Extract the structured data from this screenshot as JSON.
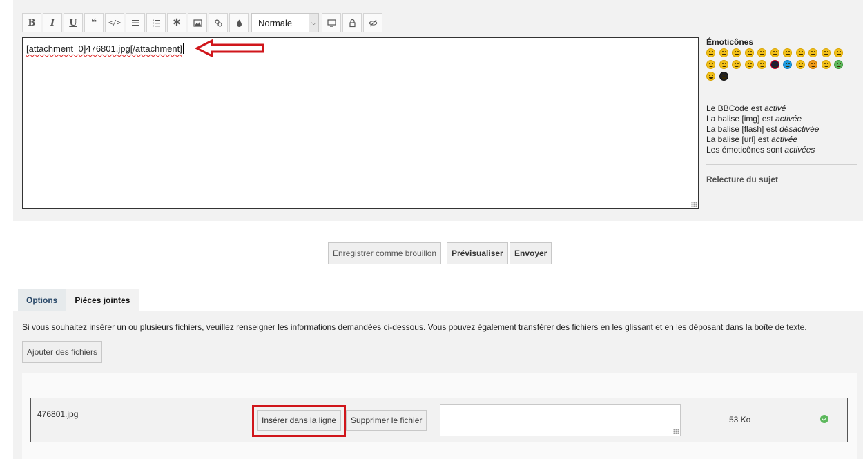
{
  "toolbar": {
    "buttons": [
      "bold-button",
      "italic-button",
      "underline-button",
      "quote-button",
      "code-button",
      "list-button",
      "numbered-list-button",
      "list-item-button",
      "image-button",
      "link-button",
      "color-button"
    ],
    "bold_label": "B",
    "italic_label": "I",
    "underline_label": "U",
    "font_size_value": "Normale"
  },
  "editor": {
    "content": "[attachment=0]476801.jpg[/attachment]"
  },
  "sidebar": {
    "emoticons_title": "Émoticônes",
    "bbcode_lines": [
      {
        "prefix": "Le BBCode est ",
        "state": "activé"
      },
      {
        "prefix": "La balise [img] est ",
        "state": "activée"
      },
      {
        "prefix": "La balise [flash] est ",
        "state": "désactivée"
      },
      {
        "prefix": "La balise [url] est ",
        "state": "activée"
      },
      {
        "prefix": "Les émoticônes sont ",
        "state": "activées"
      }
    ],
    "topic_review": "Relecture du sujet"
  },
  "actions": {
    "save_draft": "Enregistrer comme brouillon",
    "preview": "Prévisualiser",
    "submit": "Envoyer"
  },
  "tabs": {
    "options": "Options",
    "attachments": "Pièces jointes"
  },
  "attachments": {
    "description": "Si vous souhaitez insérer un ou plusieurs fichiers, veuillez renseigner les informations demandées ci-dessous. Vous pouvez également transférer des fichiers en les glissant et en les déposant dans la boîte de texte.",
    "add_files": "Ajouter des fichiers",
    "file": {
      "name": "476801.jpg",
      "insert_inline": "Insérer dans la ligne",
      "delete_file": "Supprimer le fichier",
      "size": "53 Ko",
      "status_icon": "check-circle-icon"
    }
  },
  "colors": {
    "annotation_red": "#d0161b",
    "success_green": "#5cb85c"
  }
}
